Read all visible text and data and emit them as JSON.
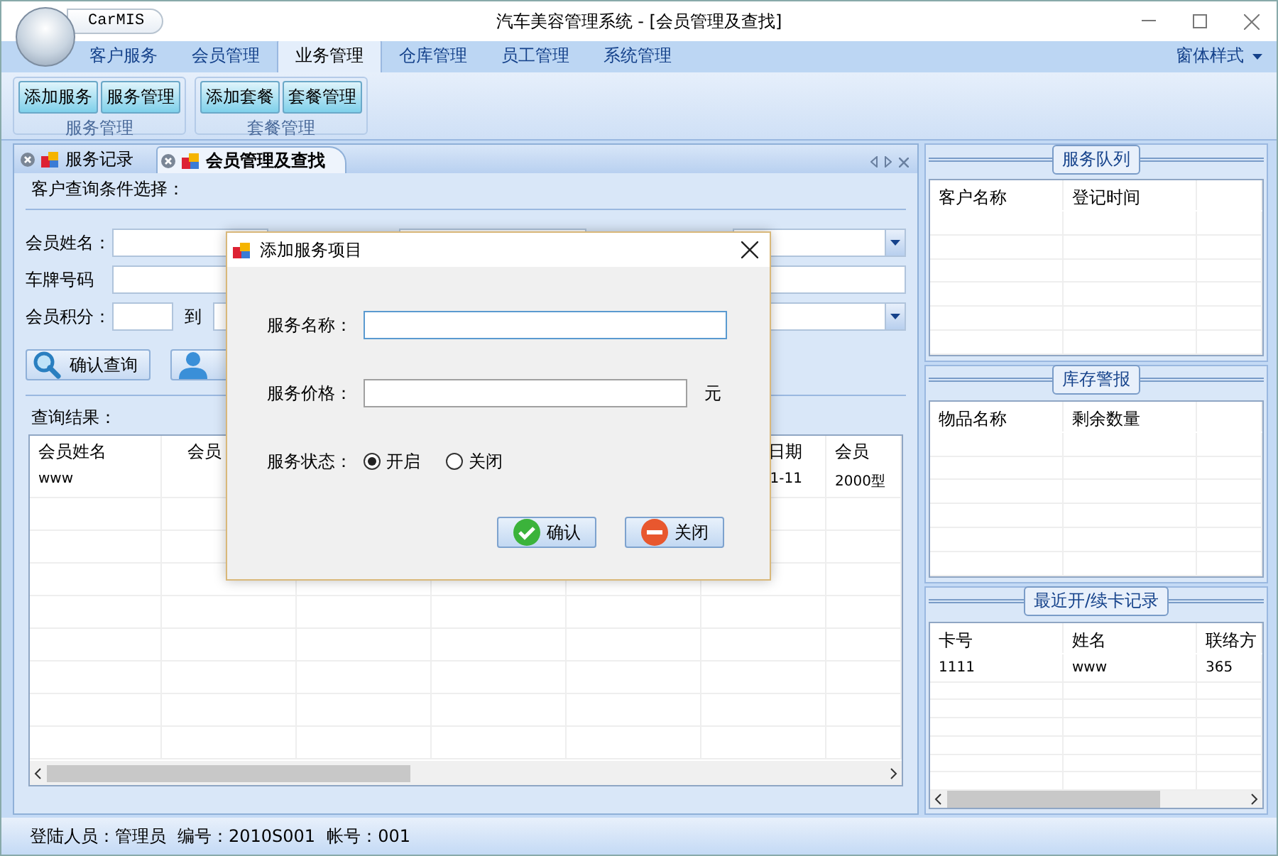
{
  "window": {
    "app_label": "CarMIS",
    "title": "汽车美容管理系统 - [会员管理及查找]"
  },
  "ribbon": {
    "tabs": [
      {
        "label": "客户服务",
        "selected": false
      },
      {
        "label": "会员管理",
        "selected": false
      },
      {
        "label": "业务管理",
        "selected": true
      },
      {
        "label": "仓库管理",
        "selected": false
      },
      {
        "label": "员工管理",
        "selected": false
      },
      {
        "label": "系统管理",
        "selected": false
      }
    ],
    "style_menu": "窗体样式",
    "groups": [
      {
        "title": "服务管理",
        "buttons": [
          "添加服务",
          "服务管理"
        ]
      },
      {
        "title": "套餐管理",
        "buttons": [
          "添加套餐",
          "套餐管理"
        ]
      }
    ]
  },
  "document_tabs": [
    {
      "label": "服务记录",
      "selected": false
    },
    {
      "label": "会员管理及查找",
      "selected": true
    }
  ],
  "query": {
    "title": "客户查询条件选择：",
    "name_label": "会员姓名：",
    "plate_label": "车牌号码",
    "points_label": "会员积分：",
    "points_to": "到",
    "buttons": [
      {
        "kind": "search",
        "label": "确认查询"
      },
      {
        "kind": "person"
      }
    ]
  },
  "results": {
    "title": "查询结果：",
    "columns": [
      {
        "label": "会员姓名"
      },
      {
        "label": "会员"
      },
      {},
      {},
      {},
      {
        "label": "日期"
      },
      {
        "label": "会员"
      }
    ],
    "rows": [
      {
        "cells": [
          {
            "text": "www"
          },
          {},
          {},
          {},
          {},
          {
            "text": "1-11"
          },
          {
            "text": "2000型"
          }
        ]
      }
    ]
  },
  "side_panels": [
    {
      "title": "服务队列",
      "columns": [
        "客户名称",
        "登记时间"
      ]
    },
    {
      "title": "库存警报",
      "columns": [
        "物品名称",
        "剩余数量"
      ]
    },
    {
      "title": "最近开/续卡记录",
      "columns": [
        "卡号",
        "姓名",
        "联络方"
      ],
      "rows": [
        [
          "1111",
          "www",
          "365"
        ]
      ],
      "scrollbar": true
    }
  ],
  "status_bar": [
    "登陆人员：管理员",
    "编号：2010S001",
    "帐号：001"
  ],
  "dialog": {
    "title": "添加服务项目",
    "name_label": "服务名称：",
    "price_label": "服务价格：",
    "price_unit": "元",
    "status_label": "服务状态：",
    "status_options": [
      {
        "label": "开启",
        "selected": true
      },
      {
        "label": "关闭",
        "selected": false
      }
    ],
    "buttons": [
      {
        "kind": "ok",
        "label": "确认"
      },
      {
        "kind": "cancel",
        "label": "关闭"
      }
    ]
  }
}
